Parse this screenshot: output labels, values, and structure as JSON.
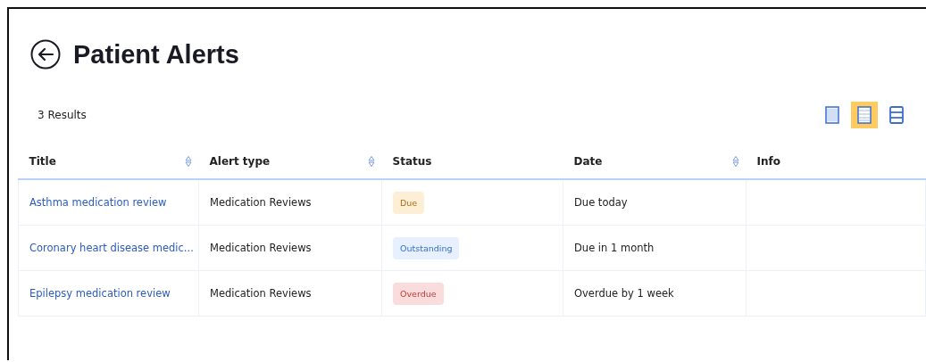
{
  "header": {
    "title": "Patient Alerts"
  },
  "results": {
    "count": "3 Results"
  },
  "view_toggles": [
    {
      "kind": "compact",
      "selected": false
    },
    {
      "kind": "normal",
      "selected": true
    },
    {
      "kind": "spacious",
      "selected": false
    }
  ],
  "table": {
    "columns": [
      {
        "label": "Title",
        "sortable": true
      },
      {
        "label": "Alert type",
        "sortable": true
      },
      {
        "label": "Status",
        "sortable": false
      },
      {
        "label": "Date",
        "sortable": true
      },
      {
        "label": "Info",
        "sortable": false
      }
    ],
    "rows": [
      {
        "title": "Asthma medication review",
        "alert_type": "Medication Reviews",
        "status": {
          "label": "Due",
          "kind": "due"
        },
        "date": "Due today"
      },
      {
        "title": "Coronary heart disease medic...",
        "alert_type": "Medication Reviews",
        "status": {
          "label": "Outstanding",
          "kind": "outstanding"
        },
        "date": "Due in 1 month"
      },
      {
        "title": "Epilepsy medication review",
        "alert_type": "Medication Reviews",
        "status": {
          "label": "Overdue",
          "kind": "overdue"
        },
        "date": "Overdue by 1 week"
      }
    ]
  }
}
